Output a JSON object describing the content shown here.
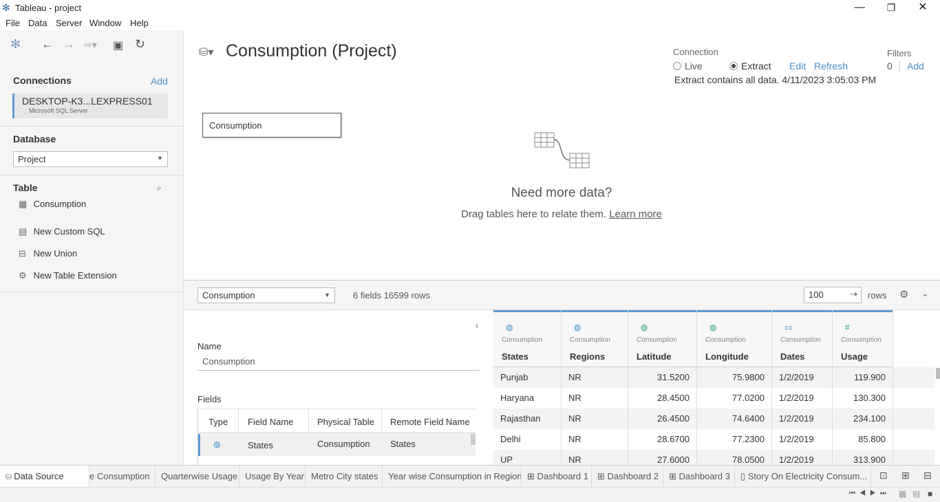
{
  "window": {
    "title": "Tableau - project",
    "controls": {
      "minimize": "—",
      "restore": "❐",
      "close": "✕"
    }
  },
  "menu": [
    "File",
    "Data",
    "Server",
    "Window",
    "Help"
  ],
  "left": {
    "connections_title": "Connections",
    "connections_add": "Add",
    "connection_name": "DESKTOP-K3...LEXPRESS01",
    "connection_type": "Microsoft SQL Server",
    "database_title": "Database",
    "database_value": "Project",
    "table_title": "Table",
    "tables": [
      {
        "icon": "table-icon",
        "label": "Consumption"
      },
      {
        "icon": "custom-sql-icon",
        "label": "New Custom SQL"
      },
      {
        "icon": "union-icon",
        "label": "New Union"
      },
      {
        "icon": "extension-icon",
        "label": "New Table Extension"
      }
    ]
  },
  "canvas": {
    "title": "Consumption (Project)",
    "connection_label": "Connection",
    "live_label": "Live",
    "extract_label": "Extract",
    "edit_link": "Edit",
    "refresh_link": "Refresh",
    "extract_info": "Extract contains all data. 4/11/2023 3:05:03 PM",
    "filters_label": "Filters",
    "filters_count": "0",
    "filters_add": "Add",
    "table_box": "Consumption",
    "need_more": "Need more data?",
    "drag_hint": "Drag tables here to relate them.",
    "learn_more": "Learn more"
  },
  "bottom": {
    "table_select": "Consumption",
    "summary": "6 fields 16599 rows",
    "rows_value": "100",
    "rows_label": "rows",
    "name_label": "Name",
    "name_value": "Consumption",
    "fields_label": "Fields",
    "fields_headers": [
      "Type",
      "Field Name",
      "Physical Table",
      "Remote Field Name"
    ],
    "fields_rows": [
      {
        "type_icon": "globe-icon",
        "field": "States",
        "table": "Consumption",
        "remote": "States"
      }
    ]
  },
  "grid": {
    "columns": [
      {
        "icon": "globe-icon",
        "source": "Consumption",
        "name": "States"
      },
      {
        "icon": "globe-icon",
        "source": "Consumption",
        "name": "Regions"
      },
      {
        "icon": "globe-icon",
        "source": "Consumption",
        "name": "Latitude"
      },
      {
        "icon": "globe-icon",
        "source": "Consumption",
        "name": "Longitude"
      },
      {
        "icon": "calendar-icon",
        "source": "Consumption",
        "name": "Dates"
      },
      {
        "icon": "number-icon",
        "source": "Consumption",
        "name": "Usage"
      }
    ],
    "rows": [
      [
        "Punjab",
        "NR",
        "31.5200",
        "75.9800",
        "1/2/2019",
        "119.900"
      ],
      [
        "Haryana",
        "NR",
        "28.4500",
        "77.0200",
        "1/2/2019",
        "130.300"
      ],
      [
        "Rajasthan",
        "NR",
        "26.4500",
        "74.6400",
        "1/2/2019",
        "234.100"
      ],
      [
        "Delhi",
        "NR",
        "28.6700",
        "77.2300",
        "1/2/2019",
        "85.800"
      ],
      [
        "UP",
        "NR",
        "27.6000",
        "78.0500",
        "1/2/2019",
        "313.900"
      ]
    ]
  },
  "tabs": [
    "Data Source",
    "e Consumption",
    "Quarterwise Usage",
    "Usage By Year",
    "Metro City states",
    "Year wise Consumption in Region",
    "Dashboard 1",
    "Dashboard 2",
    "Dashboard 3",
    "Story On Electricity Consum..."
  ]
}
